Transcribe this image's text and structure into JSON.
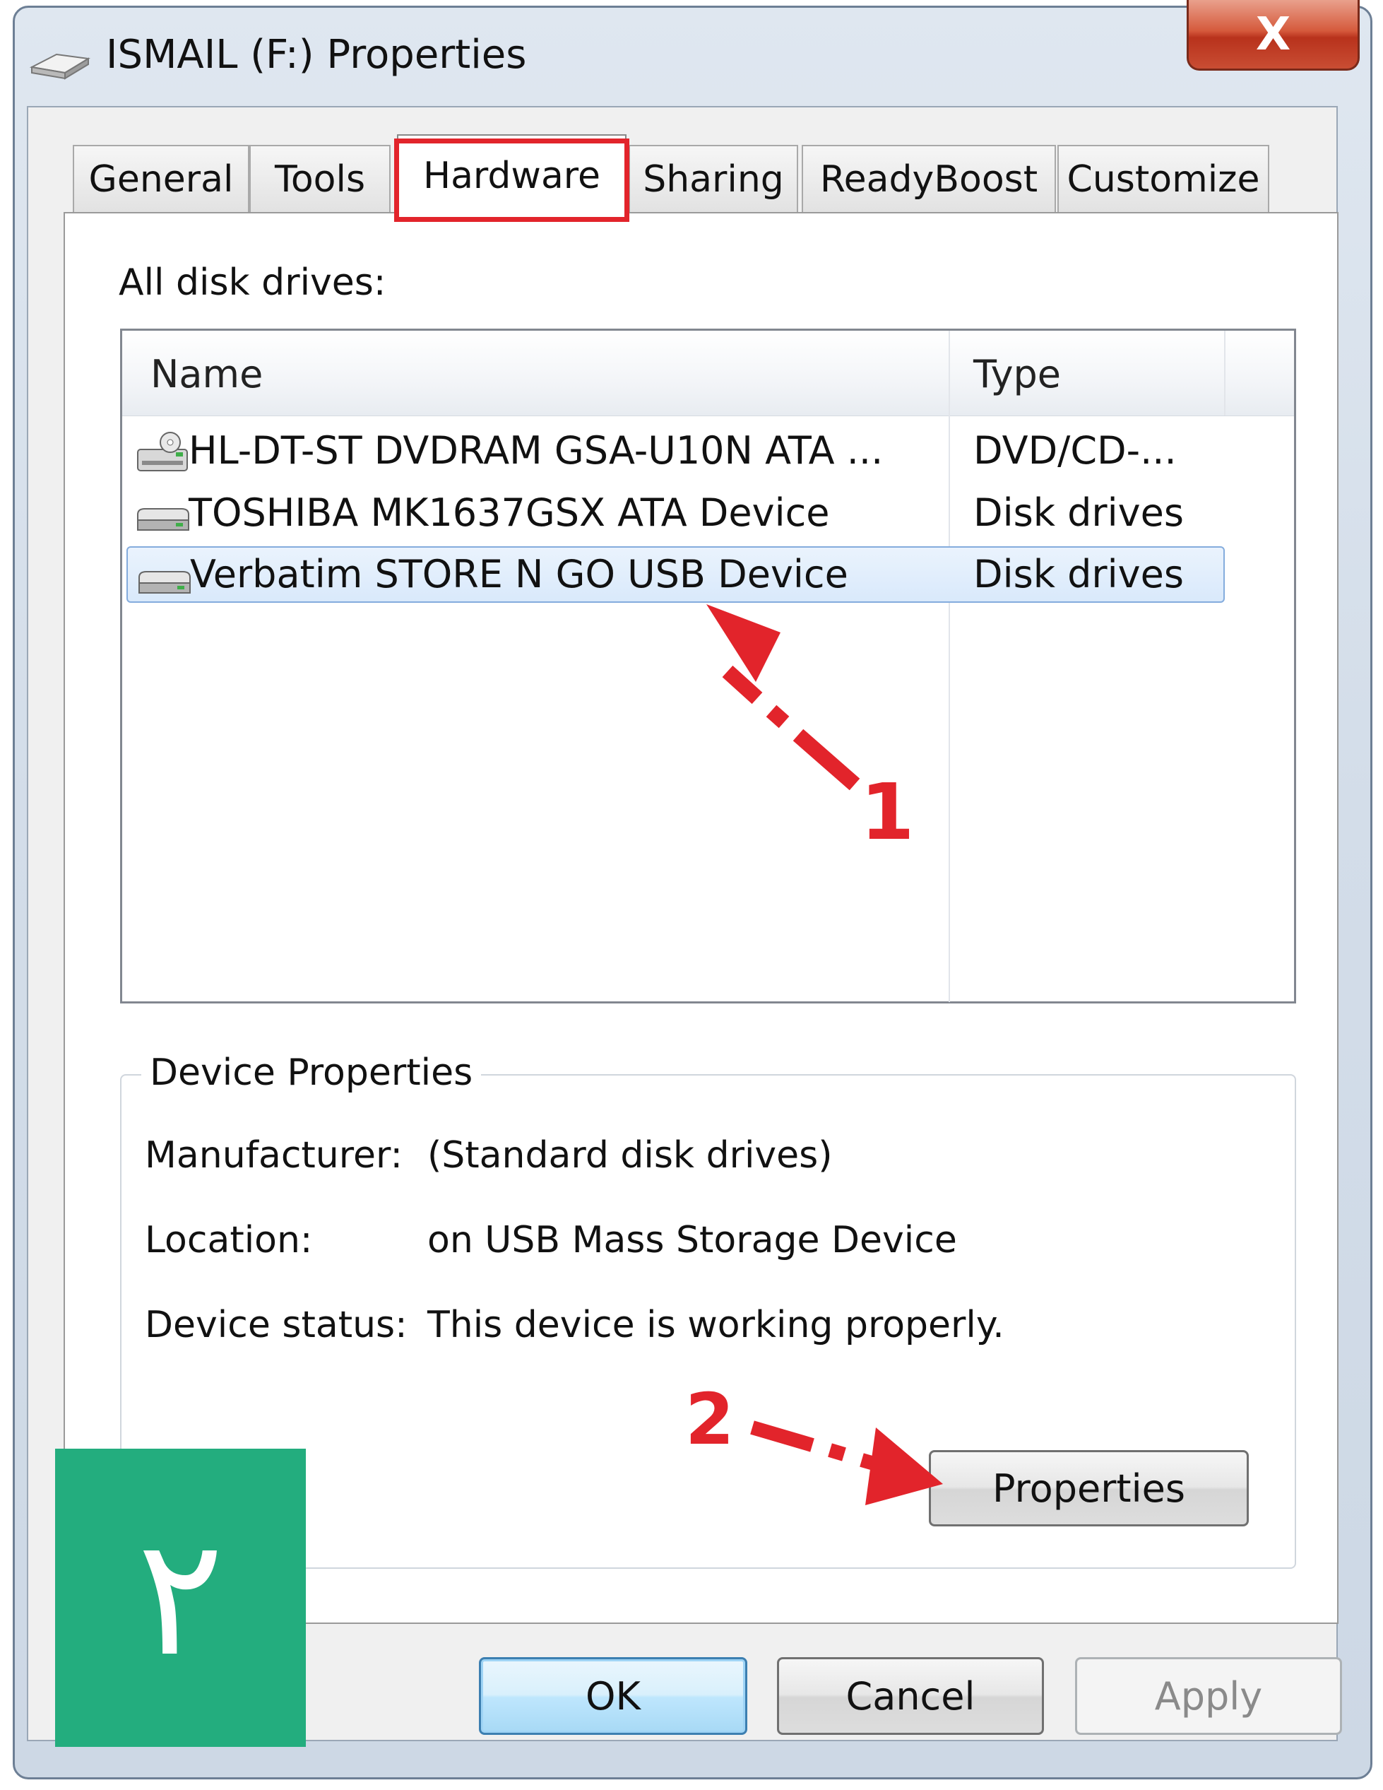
{
  "window": {
    "title": "ISMAIL (F:) Properties",
    "close_label": "X"
  },
  "tabs": [
    {
      "label": "General"
    },
    {
      "label": "Tools"
    },
    {
      "label": "Hardware",
      "active": true
    },
    {
      "label": "Sharing"
    },
    {
      "label": "ReadyBoost"
    },
    {
      "label": "Customize"
    }
  ],
  "hardware": {
    "list_label": "All disk drives:",
    "columns": {
      "name": "Name",
      "type": "Type"
    },
    "drives": [
      {
        "name": "HL-DT-ST DVDRAM GSA-U10N ATA ...",
        "type": "DVD/CD-...",
        "icon": "dvd-drive-icon"
      },
      {
        "name": "TOSHIBA MK1637GSX ATA Device",
        "type": "Disk drives",
        "icon": "disk-drive-icon"
      },
      {
        "name": "Verbatim STORE N GO USB Device",
        "type": "Disk drives",
        "icon": "disk-drive-icon",
        "selected": true
      }
    ]
  },
  "device_properties": {
    "title": "Device Properties",
    "manufacturer_label": "Manufacturer:",
    "manufacturer_value": "(Standard disk drives)",
    "location_label": "Location:",
    "location_value": "on USB Mass Storage Device",
    "status_label": "Device status:",
    "status_value": "This device is working properly.",
    "properties_button": "Properties"
  },
  "buttons": {
    "ok": "OK",
    "cancel": "Cancel",
    "apply": "Apply"
  },
  "annotations": {
    "step1": "1",
    "step2": "2",
    "badge": "٢",
    "highlight_color": "#e2242b",
    "badge_color": "#23ad7e"
  }
}
